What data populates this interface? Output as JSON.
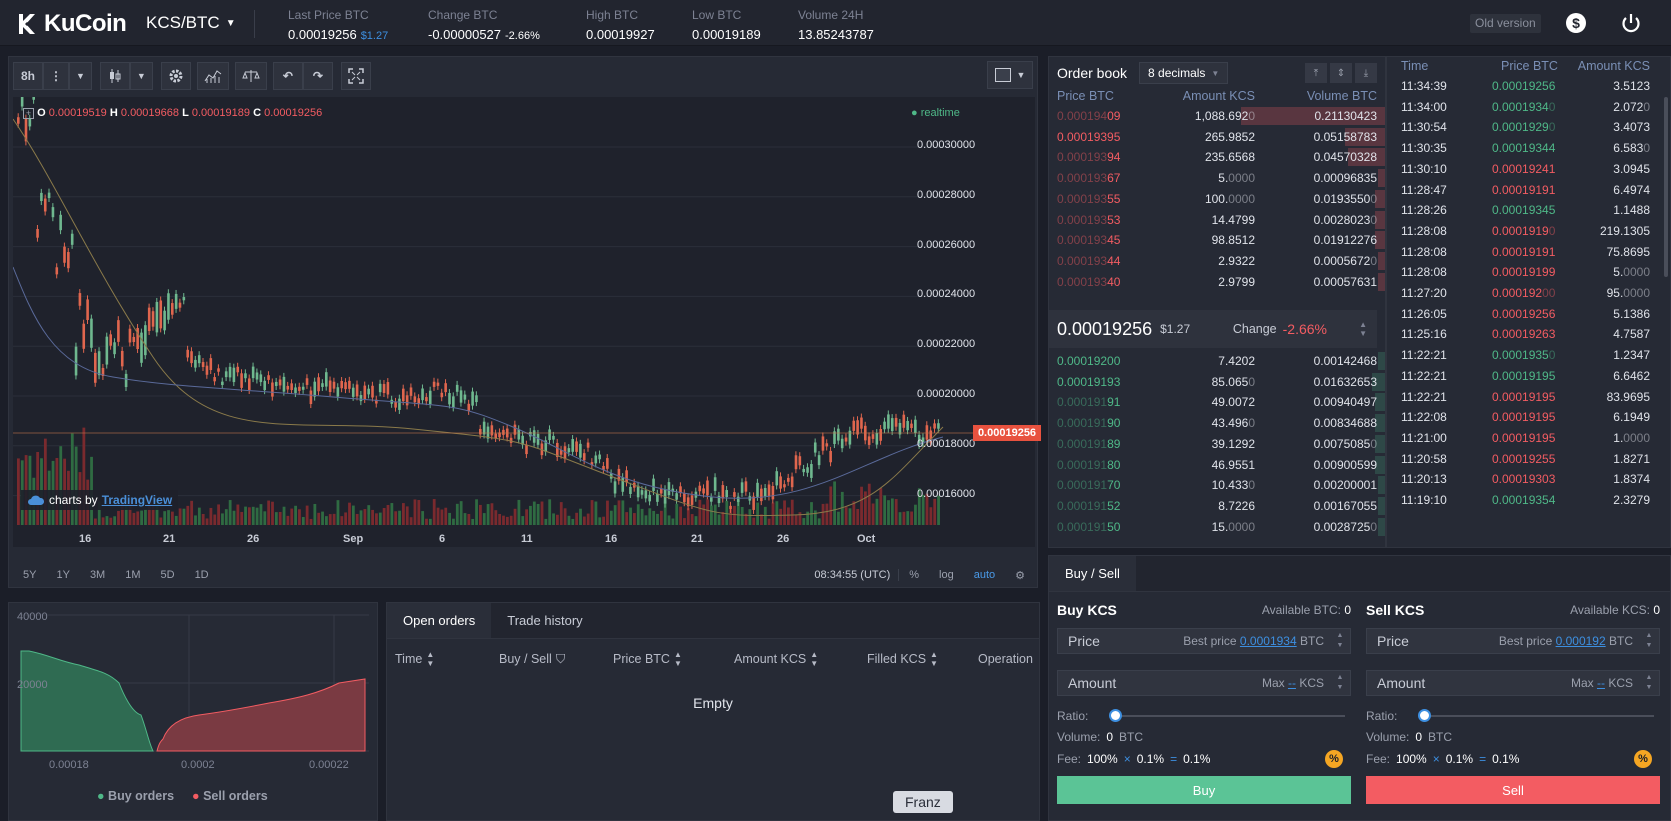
{
  "header": {
    "logo_text": "KuCoin",
    "pair": "KCS/BTC",
    "stats": {
      "last_price": {
        "label": "Last Price BTC",
        "value": "0.00019256",
        "sub": "$1.27"
      },
      "change": {
        "label": "Change BTC",
        "value": "-0.00000527",
        "sub": "-2.66%"
      },
      "high": {
        "label": "High BTC",
        "value": "0.00019927"
      },
      "low": {
        "label": "Low BTC",
        "value": "0.00019189"
      },
      "volume": {
        "label": "Volume 24H",
        "value": "13.85243787"
      }
    },
    "old_version": "Old version"
  },
  "chart": {
    "interval": "8h",
    "ohlc": {
      "o_label": "O",
      "o": "0.00019519",
      "h_label": "H",
      "h": "0.00019668",
      "l_label": "L",
      "l": "0.00019189",
      "c_label": "C",
      "c": "0.00019256"
    },
    "realtime": "realtime",
    "attribution": "charts by",
    "attribution_link": "TradingView",
    "current_price_tag": "0.00019256",
    "y_ticks": [
      "0.00030000",
      "0.00028000",
      "0.00026000",
      "0.00024000",
      "0.00022000",
      "0.00020000",
      "0.00018000",
      "0.00016000"
    ],
    "x_ticks": [
      "16",
      "21",
      "26",
      "Sep",
      "6",
      "11",
      "16",
      "21",
      "26",
      "Oct"
    ],
    "ranges": [
      "5Y",
      "1Y",
      "3M",
      "1M",
      "5D",
      "1D"
    ],
    "time": "08:34:55 (UTC)",
    "percent": "%",
    "log": "log",
    "auto": "auto"
  },
  "depth": {
    "y_ticks": [
      "40000",
      "20000"
    ],
    "x_ticks": [
      "0.00018",
      "0.0002",
      "0.00022"
    ],
    "legend_buy": "Buy orders",
    "legend_sell": "Sell orders"
  },
  "orders": {
    "tabs": [
      "Open orders",
      "Trade history"
    ],
    "columns": [
      "Time",
      "Buy / Sell",
      "Price BTC",
      "Amount KCS",
      "Filled KCS",
      "Operation"
    ],
    "empty": "Empty",
    "tooltip": "Franz"
  },
  "order_book": {
    "title": "Order book",
    "decimals": "8 decimals",
    "columns": [
      "Price BTC",
      "Amount KCS",
      "Volume BTC"
    ],
    "asks": [
      {
        "p1": "0.000194",
        "p2": "09",
        "a1": "1,088.692",
        "a2": "0",
        "v": "0.21130423",
        "depth": 0.43
      },
      {
        "p1": "0.00019395",
        "p2": "",
        "a1": "265.9852",
        "a2": "",
        "v": "0.05158783",
        "depth": 0.12
      },
      {
        "p1": "0.000193",
        "p2": "94",
        "a1": "235.6568",
        "a2": "",
        "v": "0.04570328",
        "depth": 0.11
      },
      {
        "p1": "0.000193",
        "p2": "67",
        "a1": "5.",
        "a2": "0000",
        "v": "0.00096835",
        "depth": 0.02
      },
      {
        "p1": "0.000193",
        "p2": "55",
        "a1": "100.",
        "a2": "0000",
        "v": "0.0193550",
        "v2": "0",
        "depth": 0.03
      },
      {
        "p1": "0.000193",
        "p2": "53",
        "a1": "14.4799",
        "a2": "",
        "v": "0.0028023",
        "v2": "0",
        "depth": 0.03
      },
      {
        "p1": "0.000193",
        "p2": "45",
        "a1": "98.8512",
        "a2": "",
        "v": "0.01912276",
        "depth": 0.03
      },
      {
        "p1": "0.000193",
        "p2": "44",
        "a1": "2.9322",
        "a2": "",
        "v": "0.0005672",
        "v2": "0",
        "depth": 0.02
      },
      {
        "p1": "0.000193",
        "p2": "40",
        "a1": "2.9799",
        "a2": "",
        "v": "0.00057631",
        "depth": 0.02
      }
    ],
    "mid_price": "0.00019256",
    "mid_usd": "$1.27",
    "mid_change_label": "Change",
    "mid_change": "-2.66%",
    "bids": [
      {
        "p1": "0.00019200",
        "p2": "",
        "a1": "7.4202",
        "a2": "",
        "v": "0.00142468",
        "depth": 0.02
      },
      {
        "p1": "0.00019193",
        "p2": "",
        "a1": "85.065",
        "a2": "0",
        "v": "0.01632653",
        "depth": 0.04
      },
      {
        "p1": "0.000191",
        "p2": "91",
        "a1": "49.0072",
        "a2": "",
        "v": "0.00940497",
        "depth": 0.03
      },
      {
        "p1": "0.000191",
        "p2": "90",
        "a1": "43.496",
        "a2": "0",
        "v": "0.00834688",
        "depth": 0.03
      },
      {
        "p1": "0.000191",
        "p2": "89",
        "a1": "39.1292",
        "a2": "",
        "v": "0.0075085",
        "v2": "0",
        "depth": 0.03
      },
      {
        "p1": "0.000191",
        "p2": "80",
        "a1": "46.9551",
        "a2": "",
        "v": "0.00900599",
        "depth": 0.03
      },
      {
        "p1": "0.000191",
        "p2": "70",
        "a1": "10.433",
        "a2": "0",
        "v": "0.00200001",
        "depth": 0.02
      },
      {
        "p1": "0.000191",
        "p2": "52",
        "a1": "8.7226",
        "a2": "",
        "v": "0.00167055",
        "depth": 0.02
      },
      {
        "p1": "0.000191",
        "p2": "50",
        "a1": "15.",
        "a2": "0000",
        "v": "0.0028725",
        "v2": "0",
        "depth": 0.02
      }
    ]
  },
  "trades": {
    "columns": [
      "Time",
      "Price BTC",
      "Amount KCS"
    ],
    "rows": [
      {
        "t": "11:34:39",
        "p": "0.00019256",
        "p2": "",
        "a": "3.5123",
        "a2": "",
        "side": "buy"
      },
      {
        "t": "11:34:00",
        "p": "0.0001934",
        "p2": "0",
        "a": "2.072",
        "a2": "0",
        "side": "buy"
      },
      {
        "t": "11:30:54",
        "p": "0.0001929",
        "p2": "0",
        "a": "3.4073",
        "a2": "",
        "side": "buy"
      },
      {
        "t": "11:30:35",
        "p": "0.00019344",
        "p2": "",
        "a": "6.583",
        "a2": "0",
        "side": "buy"
      },
      {
        "t": "11:30:10",
        "p": "0.00019241",
        "p2": "",
        "a": "3.0945",
        "a2": "",
        "side": "sell"
      },
      {
        "t": "11:28:47",
        "p": "0.00019191",
        "p2": "",
        "a": "6.4974",
        "a2": "",
        "side": "sell"
      },
      {
        "t": "11:28:26",
        "p": "0.00019345",
        "p2": "",
        "a": "1.1488",
        "a2": "",
        "side": "buy"
      },
      {
        "t": "11:28:08",
        "p": "0.0001919",
        "p2": "0",
        "a": "219.1305",
        "a2": "",
        "side": "sell"
      },
      {
        "t": "11:28:08",
        "p": "0.00019191",
        "p2": "",
        "a": "75.8695",
        "a2": "",
        "side": "sell"
      },
      {
        "t": "11:28:08",
        "p": "0.00019199",
        "p2": "",
        "a": "5.",
        "a2": "0000",
        "side": "sell"
      },
      {
        "t": "11:27:20",
        "p": "0.000192",
        "p2": "00",
        "a": "95.",
        "a2": "0000",
        "side": "sell"
      },
      {
        "t": "11:26:05",
        "p": "0.00019256",
        "p2": "",
        "a": "5.1386",
        "a2": "",
        "side": "sell"
      },
      {
        "t": "11:25:16",
        "p": "0.00019263",
        "p2": "",
        "a": "4.7587",
        "a2": "",
        "side": "sell"
      },
      {
        "t": "11:22:21",
        "p": "0.0001935",
        "p2": "0",
        "a": "1.2347",
        "a2": "",
        "side": "buy"
      },
      {
        "t": "11:22:21",
        "p": "0.00019195",
        "p2": "",
        "a": "6.6462",
        "a2": "",
        "side": "buy"
      },
      {
        "t": "11:22:21",
        "p": "0.00019195",
        "p2": "",
        "a": "83.9695",
        "a2": "",
        "side": "sell"
      },
      {
        "t": "11:22:08",
        "p": "0.00019195",
        "p2": "",
        "a": "6.1949",
        "a2": "",
        "side": "sell"
      },
      {
        "t": "11:21:00",
        "p": "0.00019195",
        "p2": "",
        "a": "1.",
        "a2": "0000",
        "side": "sell"
      },
      {
        "t": "11:20:58",
        "p": "0.00019255",
        "p2": "",
        "a": "1.8271",
        "a2": "",
        "side": "sell"
      },
      {
        "t": "11:20:13",
        "p": "0.00019303",
        "p2": "",
        "a": "1.8374",
        "a2": "",
        "side": "sell"
      },
      {
        "t": "11:19:10",
        "p": "0.00019354",
        "p2": "",
        "a": "2.3279",
        "a2": "",
        "side": "buy"
      }
    ]
  },
  "trade_form": {
    "tab": "Buy / Sell",
    "buy": {
      "title": "Buy KCS",
      "available_label": "Available BTC:",
      "available": "0",
      "price_ph": "Price",
      "best_price_label": "Best price",
      "best_price": "0.0001934",
      "price_unit": "BTC",
      "amount_ph": "Amount",
      "max_label": "Max",
      "max_value": "--",
      "amount_unit": "KCS",
      "ratio_label": "Ratio:",
      "volume_label": "Volume:",
      "volume": "0",
      "volume_unit": "BTC",
      "fee_label": "Fee:",
      "fee1": "100%",
      "x": "×",
      "fee2": "0.1%",
      "eq": "=",
      "fee3": "0.1%",
      "button": "Buy"
    },
    "sell": {
      "title": "Sell KCS",
      "available_label": "Available KCS:",
      "available": "0",
      "price_ph": "Price",
      "best_price_label": "Best price",
      "best_price": "0.000192",
      "price_unit": "BTC",
      "amount_ph": "Amount",
      "max_label": "Max",
      "max_value": "--",
      "amount_unit": "KCS",
      "ratio_label": "Ratio:",
      "volume_label": "Volume:",
      "volume": "0",
      "volume_unit": "BTC",
      "fee_label": "Fee:",
      "fee1": "100%",
      "x": "×",
      "fee2": "0.1%",
      "eq": "=",
      "fee3": "0.1%",
      "button": "Sell"
    }
  },
  "colors": {
    "buy": "#4fb888",
    "sell": "#f35c62",
    "accent": "#3d8fe0",
    "buy_button": "#5bc496",
    "sell_button": "#f35c62"
  }
}
